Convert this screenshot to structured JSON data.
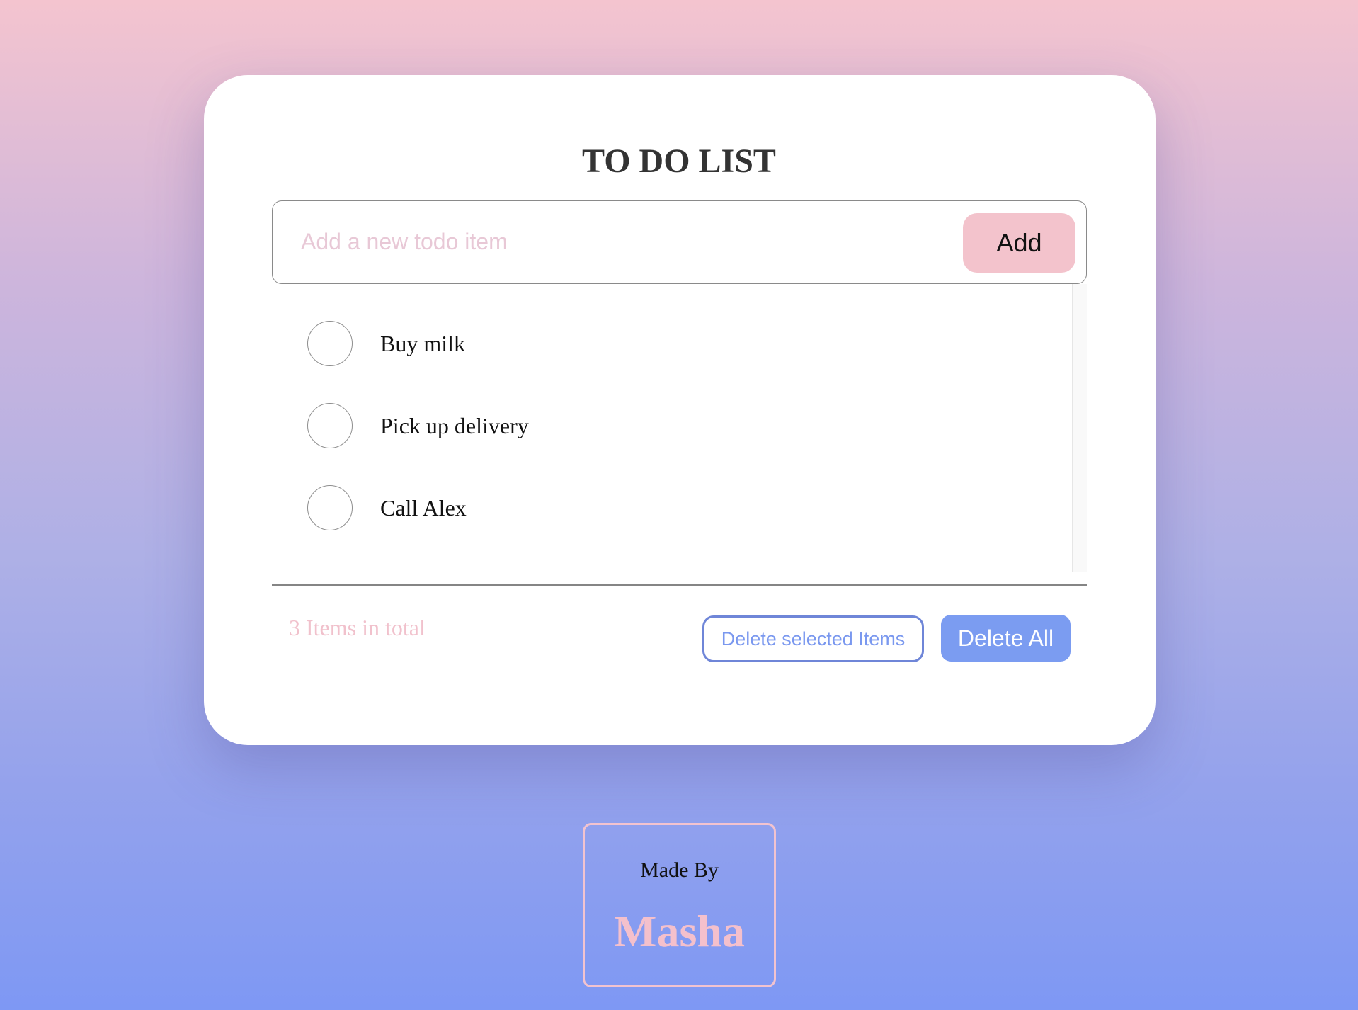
{
  "app": {
    "title": "TO DO LIST"
  },
  "input": {
    "placeholder": "Add a new todo item",
    "value": ""
  },
  "add_button": {
    "label": "Add"
  },
  "todos": [
    {
      "text": "Buy milk",
      "checked": false
    },
    {
      "text": "Pick up delivery",
      "checked": false
    },
    {
      "text": "Call Alex",
      "checked": false
    }
  ],
  "footer": {
    "count_text": "3 Items in total",
    "delete_selected_label": "Delete selected Items",
    "delete_all_label": "Delete All"
  },
  "credit": {
    "label": "Made By",
    "name": "Masha"
  },
  "colors": {
    "accent_pink": "#f3c3cc",
    "accent_blue": "#7b9cf1",
    "title": "#333333"
  }
}
